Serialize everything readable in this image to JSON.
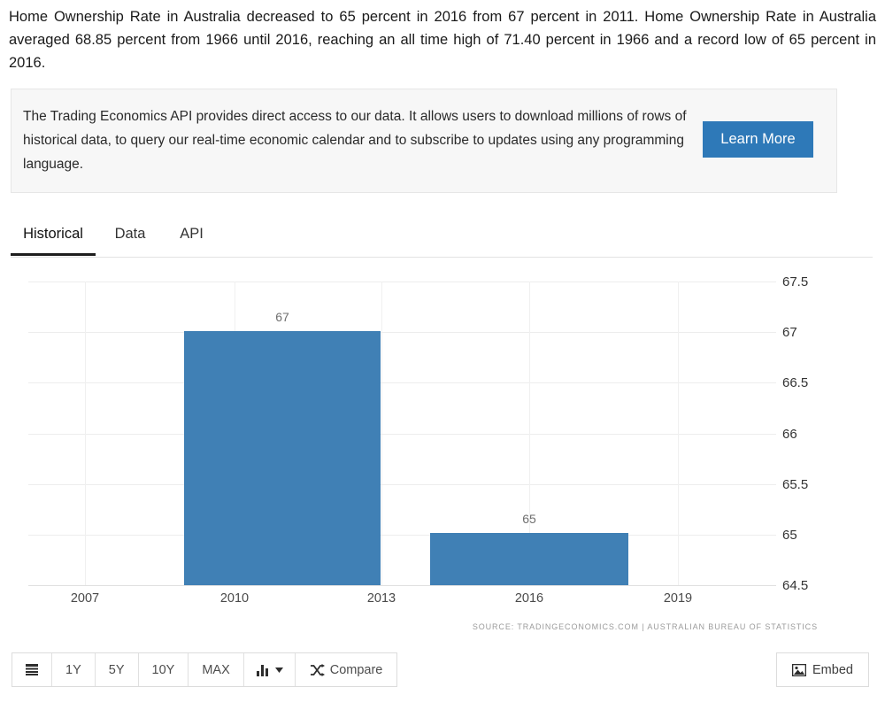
{
  "intro": {
    "text": "Home Ownership Rate in Australia decreased to 65 percent in 2016 from 67 percent in 2011. Home Ownership Rate in Australia averaged 68.85 percent from 1966 until 2016, reaching an all time high of 71.40 percent in 1966 and a record low of 65 percent in 2016."
  },
  "promo": {
    "text": "The Trading Economics API provides direct access to our data. It allows users to download millions of rows of historical data, to query our real-time economic calendar and to subscribe to updates using any programming language.",
    "button_label": "Learn More",
    "button_color": "#2e79b8"
  },
  "tabs": [
    {
      "label": "Historical",
      "active": true
    },
    {
      "label": "Data",
      "active": false
    },
    {
      "label": "API",
      "active": false
    }
  ],
  "toolbar": {
    "items": [
      {
        "label": "",
        "icon": "list-icon"
      },
      {
        "label": "1Y",
        "icon": ""
      },
      {
        "label": "5Y",
        "icon": ""
      },
      {
        "label": "10Y",
        "icon": ""
      },
      {
        "label": "MAX",
        "icon": ""
      },
      {
        "label": "",
        "icon": "chart-type-dropdown-icon"
      },
      {
        "label": "Compare",
        "icon": "shuffle-icon"
      }
    ],
    "embed_label": "Embed",
    "embed_icon": "image-icon"
  },
  "chart_data": {
    "type": "bar",
    "title": "",
    "xlabel": "",
    "ylabel": "",
    "categories": [
      "2011",
      "2016"
    ],
    "values": [
      67,
      65
    ],
    "data_labels": [
      "67",
      "65"
    ],
    "bar_color": "#4080b5",
    "ylim": [
      64.5,
      67.5
    ],
    "yticks": [
      "67.5",
      "67",
      "66.5",
      "66",
      "65.5",
      "65",
      "64.5"
    ],
    "ytick_values": [
      67.5,
      67,
      66.5,
      66,
      65.5,
      65,
      64.5
    ],
    "xticks": [
      "2007",
      "2010",
      "2013",
      "2016",
      "2019"
    ],
    "xtick_values": [
      2007,
      2010,
      2013,
      2016,
      2019
    ],
    "grid": true,
    "legend": "none",
    "source": "SOURCE: TRADINGECONOMICS.COM | AUSTRALIAN BUREAU OF STATISTICS"
  }
}
